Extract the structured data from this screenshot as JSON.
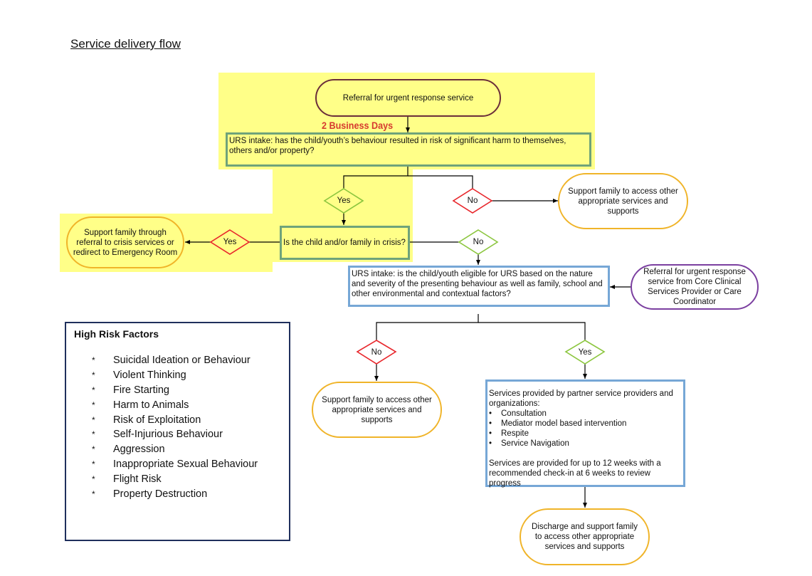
{
  "title": "Service delivery flow",
  "time_label": "2 Business Days",
  "nodes": {
    "referral": "Referral for urgent response service",
    "intake1": "URS intake: has the child/youth’s behaviour resulted in risk of significant harm to themselves, others and/or property?",
    "crisis_question": "Is the child and/or family in crisis?",
    "crisis_referral": "Support family through referral to crisis services or redirect to Emergency Room",
    "support_other_top": "Support family to access other appropriate services and supports",
    "intake2": "URS intake: is the child/youth eligible for URS based on the nature and severity of the presenting behaviour as well as family, school and other environmental and contextual factors?",
    "referral_core": "Referral for urgent response service from Core Clinical Services Provider or Care Coordinator",
    "support_other_bottom": "Support family to access other appropriate services and supports",
    "services": {
      "intro": "Services provided by partner service providers and organizations:",
      "items": [
        "Consultation",
        "Mediator model based intervention",
        "Respite",
        "Service Navigation"
      ],
      "bullet": "•",
      "note": "Services are provided for up to 12 weeks with a recommended check-in at 6 weeks to review progress"
    },
    "discharge": "Discharge and support family to access other appropriate services and supports"
  },
  "decisions": {
    "harm_yes": "Yes",
    "harm_no": "No",
    "crisis_yes": "Yes",
    "crisis_no": "No",
    "eligible_no": "No",
    "eligible_yes": "Yes"
  },
  "risk_factors": {
    "title": "High Risk Factors",
    "bullet": "*",
    "items": [
      "Suicidal Ideation or Behaviour",
      "Violent Thinking",
      "Fire Starting",
      "Harm to Animals",
      "Risk of Exploitation",
      "Self-Injurious Behaviour",
      "Aggression",
      "Inappropriate Sexual Behaviour",
      "Flight Risk",
      "Property Destruction"
    ]
  },
  "colors": {
    "highlight": "#ffff88",
    "yes_diamond": "#8cc63f",
    "no_diamond": "#e8262b",
    "time_label": "#d63a2f",
    "terminal_orange": "#f0b429",
    "terminal_purple": "#7b3fa0",
    "box_green": "#6fa37a",
    "box_blue": "#76a7d6",
    "risk_border": "#1f2f5c"
  }
}
